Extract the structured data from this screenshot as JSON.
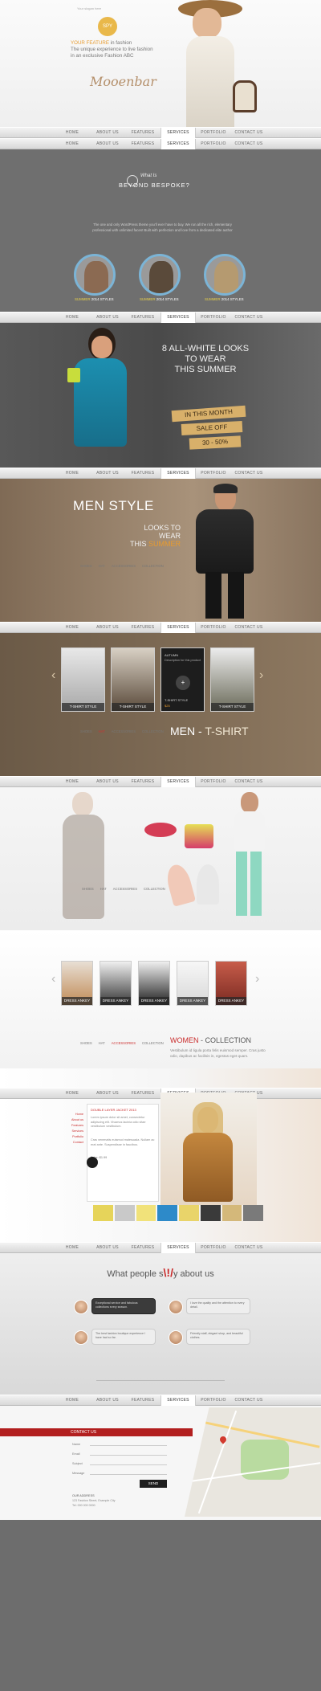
{
  "hero": {
    "top_note": "Your slogan here",
    "badge": "SPY",
    "line1_accent": "YOUR FEATURE",
    "line1_rest": "in fashion",
    "line2": "The unique experience to live fashion",
    "line3": "in an exclusive Fashion ABC",
    "signature": "Mooenbar"
  },
  "nav": [
    "HOME",
    "ABOUT US",
    "FEATURES",
    "SERVICES",
    "PORTFOLIO",
    "CONTACT US"
  ],
  "nav_active": "SERVICES",
  "about": {
    "title_small": "What Is",
    "title_big": "BEYOND BESPOKE?",
    "para": "The one and only WordPress theme you'll ever have to buy. We run all the rich, elementary professional with unlimited faces! Built with perfection and love from a dedicated elite author",
    "circles": [
      {
        "accent": "SUMMER",
        "label": "2014 STYLES"
      },
      {
        "accent": "SUMMER",
        "label": "2014 STYLES"
      },
      {
        "accent": "SUMMER",
        "label": "2014 STYLES"
      }
    ]
  },
  "white_looks": {
    "line1": "8 ALL-WHITE LOOKS",
    "line2": "TO WEAR",
    "line3": "THIS SUMMER",
    "tag1": "IN THIS MONTH",
    "tag2": "SALE OFF",
    "tag3": "30 - 50%"
  },
  "men_style": {
    "title": "MEN STYLE",
    "l1": "LOOKS TO",
    "l2": "WEAR",
    "l3_a": "THIS",
    "l3_b": "SUMMER",
    "sub": [
      "SHOES",
      "HAT",
      "ACCESSORIES",
      "COLLECTION"
    ]
  },
  "tshirt": {
    "cards": [
      "T-SHIRT STYLE",
      "T-SHIRT STYLE",
      "T-SHIRT STYLE",
      "T-SHIRT STYLE"
    ],
    "popup_title": "AUTUMN",
    "popup_desc": "Description for this product",
    "popup_price": "$25",
    "title_a": "MEN",
    "title_b": "T-SHIRT",
    "sub": [
      "SHOES",
      "HAT",
      "ACCESSORIES",
      "COLLECTION"
    ]
  },
  "women_accessory": {
    "sub": [
      "SHOES",
      "HAT",
      "ACCESSORIES",
      "COLLECTION"
    ]
  },
  "women_collection": {
    "cards": [
      "DRESS ANKEY",
      "DRESS ANKEY",
      "DRESS ANKEY",
      "DRESS ANKEY",
      "DRESS ANKEY"
    ],
    "sub": [
      "SHOES",
      "HAT",
      "ACCESSORIES",
      "COLLECTION"
    ],
    "title_a": "WOMEN",
    "title_b": "- COLLECTION",
    "para": "Vestibulum id ligula porta felis euismod semper. Cras justo odio, dapibus ac facilisis in, egestas eget quam."
  },
  "portfolio": {
    "menu": [
      "Home",
      "About us",
      "Features",
      "Services",
      "Portfolio",
      "Contact"
    ],
    "heading": "DOUBLE LAYER JACKET 2013",
    "p1": "Lorem ipsum dolor sit amet, consectetur adipiscing elit. Vivamus lacinia odio vitae vestibulum vestibulum.",
    "p2": "Cras venenatis euismod malesuada. Nullam ac erat ante. Suspendisse in faucibus.",
    "price_label": "Price:",
    "price": "$1.99"
  },
  "testimonials": {
    "title_a": "What people s",
    "title_b": "y about us",
    "quotes": [
      "Exceptional service and fabulous collections every season.",
      "I love the quality and the attention to every detail.",
      "The best fashion boutique experience I have had so far.",
      "Friendly staff, elegant shop, and beautiful clothes."
    ]
  },
  "contact": {
    "title": "CONTACT US",
    "fields": [
      "Name",
      "Email",
      "Subject",
      "Message"
    ],
    "send": "SEND",
    "address_title": "OUR ADDRESS",
    "address": "123 Fashion Street, Example City",
    "phone": "Tel: 000 000 0000"
  },
  "colors": {
    "accent_red": "#c92a2a",
    "accent_orange": "#e79b2f",
    "ring_blue": "#7bb4d6"
  }
}
